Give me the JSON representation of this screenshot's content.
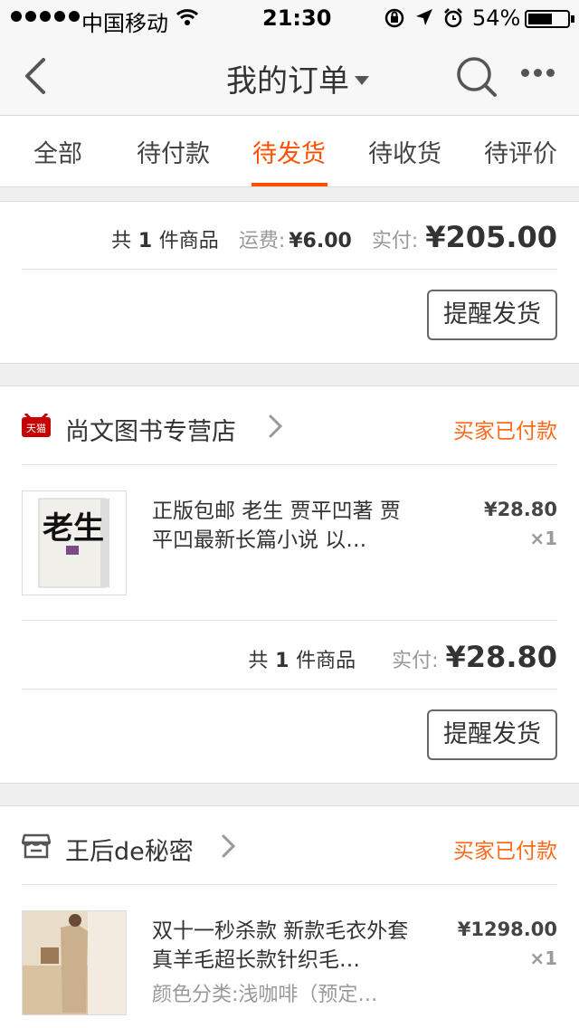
{
  "status_bar": {
    "carrier": "中国移动",
    "time": "21:30",
    "battery_pct": "54%",
    "icons": [
      "signal-dots",
      "wifi-icon",
      "rotation-lock-icon",
      "location-arrow-icon",
      "alarm-icon",
      "battery-icon"
    ]
  },
  "nav": {
    "title": "我的订单",
    "icons": [
      "back-chevron-icon",
      "dropdown-caret-icon",
      "search-icon",
      "more-dots-icon"
    ]
  },
  "tabs": [
    {
      "label": "全部",
      "active": false
    },
    {
      "label": "待付款",
      "active": false
    },
    {
      "label": "待发货",
      "active": true
    },
    {
      "label": "待收货",
      "active": false
    },
    {
      "label": "待评价",
      "active": false
    }
  ],
  "accent_color": "#ff5000",
  "orders": [
    {
      "count_prefix": "共",
      "count": "1",
      "count_suffix": "件商品",
      "shipping_label": "运费:",
      "shipping_fee": "¥6.00",
      "paid_label": "实付:",
      "paid_total": "¥205.00",
      "action": "提醒发货"
    },
    {
      "shop_icon": "tmall-icon",
      "shop_name": "尚文图书专营店",
      "status": "买家已付款",
      "item": {
        "name": "正版包邮 老生 贾平凹著 贾平凹最新长篇小说 以…",
        "price": "¥28.80",
        "qty": "×1",
        "thumb_text": "老生"
      },
      "count_prefix": "共",
      "count": "1",
      "count_suffix": "件商品",
      "paid_label": "实付:",
      "paid_total": "¥28.80",
      "action": "提醒发货"
    },
    {
      "shop_icon": "store-icon",
      "shop_name": "王后de秘密",
      "status": "买家已付款",
      "item": {
        "name": "双十一秒杀款 新款毛衣外套 真羊毛超长款针织毛…",
        "variant": "颜色分类:浅咖啡（预定…",
        "price": "¥1298.00",
        "qty": "×1"
      }
    }
  ]
}
